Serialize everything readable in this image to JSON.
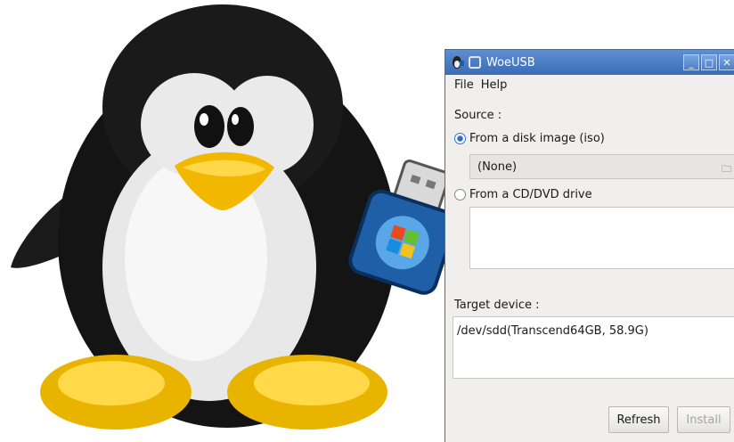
{
  "window": {
    "title": "WoeUSB",
    "title_icon": "penguin-usb-icon",
    "controls": [
      "minimize-icon",
      "maximize-icon",
      "close-icon"
    ]
  },
  "menu": {
    "items": [
      "File",
      "Help"
    ]
  },
  "source": {
    "label": "Source :",
    "option_iso": "From a disk image (iso)",
    "iso_selected": true,
    "iso_path": "(None)",
    "option_dvd": "From a CD/DVD drive"
  },
  "target": {
    "label": "Target device :",
    "devices": [
      "/dev/sdd(Transcend64GB, 58.9G)"
    ]
  },
  "buttons": {
    "refresh": "Refresh",
    "install": "Install"
  },
  "colors": {
    "titlebar": "#3a6cb4",
    "radio_accent": "#2f6fd6",
    "usb_body": "#1e5fa8"
  }
}
